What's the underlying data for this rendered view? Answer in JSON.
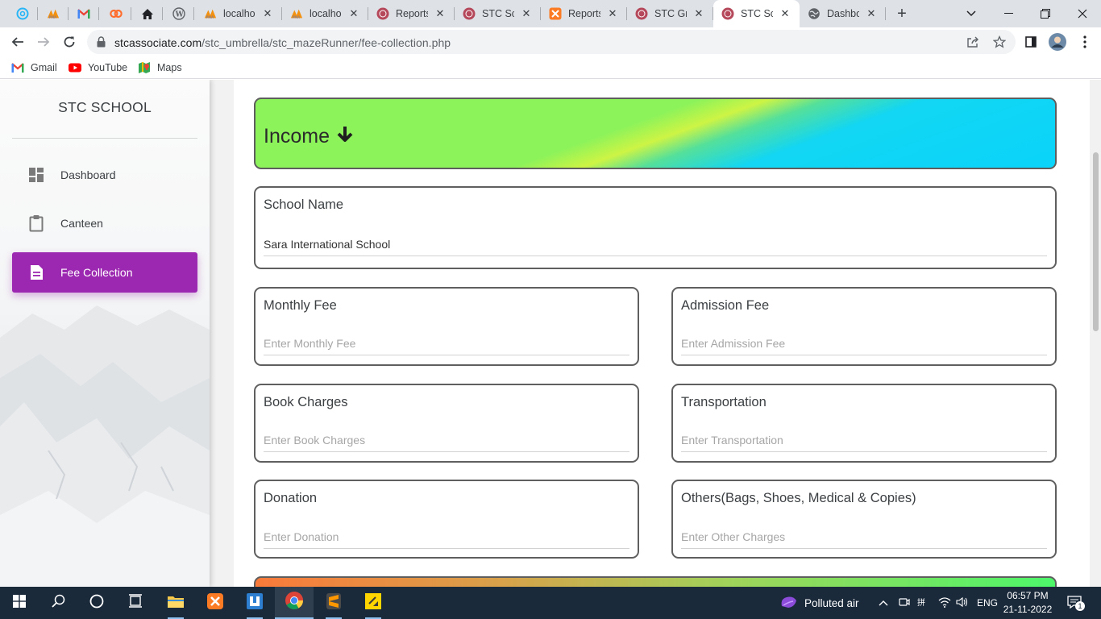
{
  "browser": {
    "pinned_tabs": [
      {
        "icon": "swirl-app-icon"
      },
      {
        "icon": "phpmyadmin-icon"
      },
      {
        "icon": "gmail-icon"
      },
      {
        "icon": "cpanel-icon"
      },
      {
        "icon": "home-icon"
      },
      {
        "icon": "wordpress-icon"
      }
    ],
    "tabs": [
      {
        "title": "localhos",
        "icon": "phpmyadmin-icon",
        "active": false
      },
      {
        "title": "localhos",
        "icon": "phpmyadmin-icon",
        "active": false
      },
      {
        "title": "Reports",
        "icon": "stc-logo-icon",
        "active": false
      },
      {
        "title": "STC Sch",
        "icon": "stc-logo-icon",
        "active": false
      },
      {
        "title": "Reports",
        "icon": "xampp-icon",
        "active": false
      },
      {
        "title": "STC Gro",
        "icon": "stc-logo-icon",
        "active": false
      },
      {
        "title": "STC Sch",
        "icon": "stc-logo-icon",
        "active": true
      },
      {
        "title": "Dashbo",
        "icon": "globe-icon",
        "active": false
      }
    ],
    "url_host": "stcassociate.com",
    "url_path": "/stc_umbrella/stc_mazeRunner/fee-collection.php",
    "bookmarks": [
      {
        "label": "Gmail",
        "icon": "gmail-icon"
      },
      {
        "label": "YouTube",
        "icon": "youtube-icon"
      },
      {
        "label": "Maps",
        "icon": "maps-icon"
      }
    ]
  },
  "sidebar": {
    "brand": "STC SCHOOL",
    "items": [
      {
        "label": "Dashboard",
        "icon": "dashboard-icon",
        "active": false
      },
      {
        "label": "Canteen",
        "icon": "clipboard-icon",
        "active": false
      },
      {
        "label": "Fee Collection",
        "icon": "document-icon",
        "active": true
      }
    ]
  },
  "main": {
    "section_title": "Income",
    "section_icon": "arrow-down-icon",
    "school_name": {
      "label": "School Name",
      "value": "Sara International School"
    },
    "monthly_fee": {
      "label": "Monthly Fee",
      "placeholder": "Enter Monthly Fee"
    },
    "admission_fee": {
      "label": "Admission Fee",
      "placeholder": "Enter Admission Fee"
    },
    "book_charges": {
      "label": "Book Charges",
      "placeholder": "Enter Book Charges"
    },
    "transportation": {
      "label": "Transportation",
      "placeholder": "Enter Transportation"
    },
    "donation": {
      "label": "Donation",
      "placeholder": "Enter Donation"
    },
    "others": {
      "label": "Others(Bags, Shoes, Medical & Copies)",
      "placeholder": "Enter Other Charges"
    }
  },
  "taskbar": {
    "weather": "Polluted air",
    "language": "ENG",
    "time": "06:57 PM",
    "date": "21-11-2022",
    "notifications": "1"
  },
  "colors": {
    "accent_purple": "#9c27b0",
    "taskbar_bg": "#1a2a3b"
  }
}
